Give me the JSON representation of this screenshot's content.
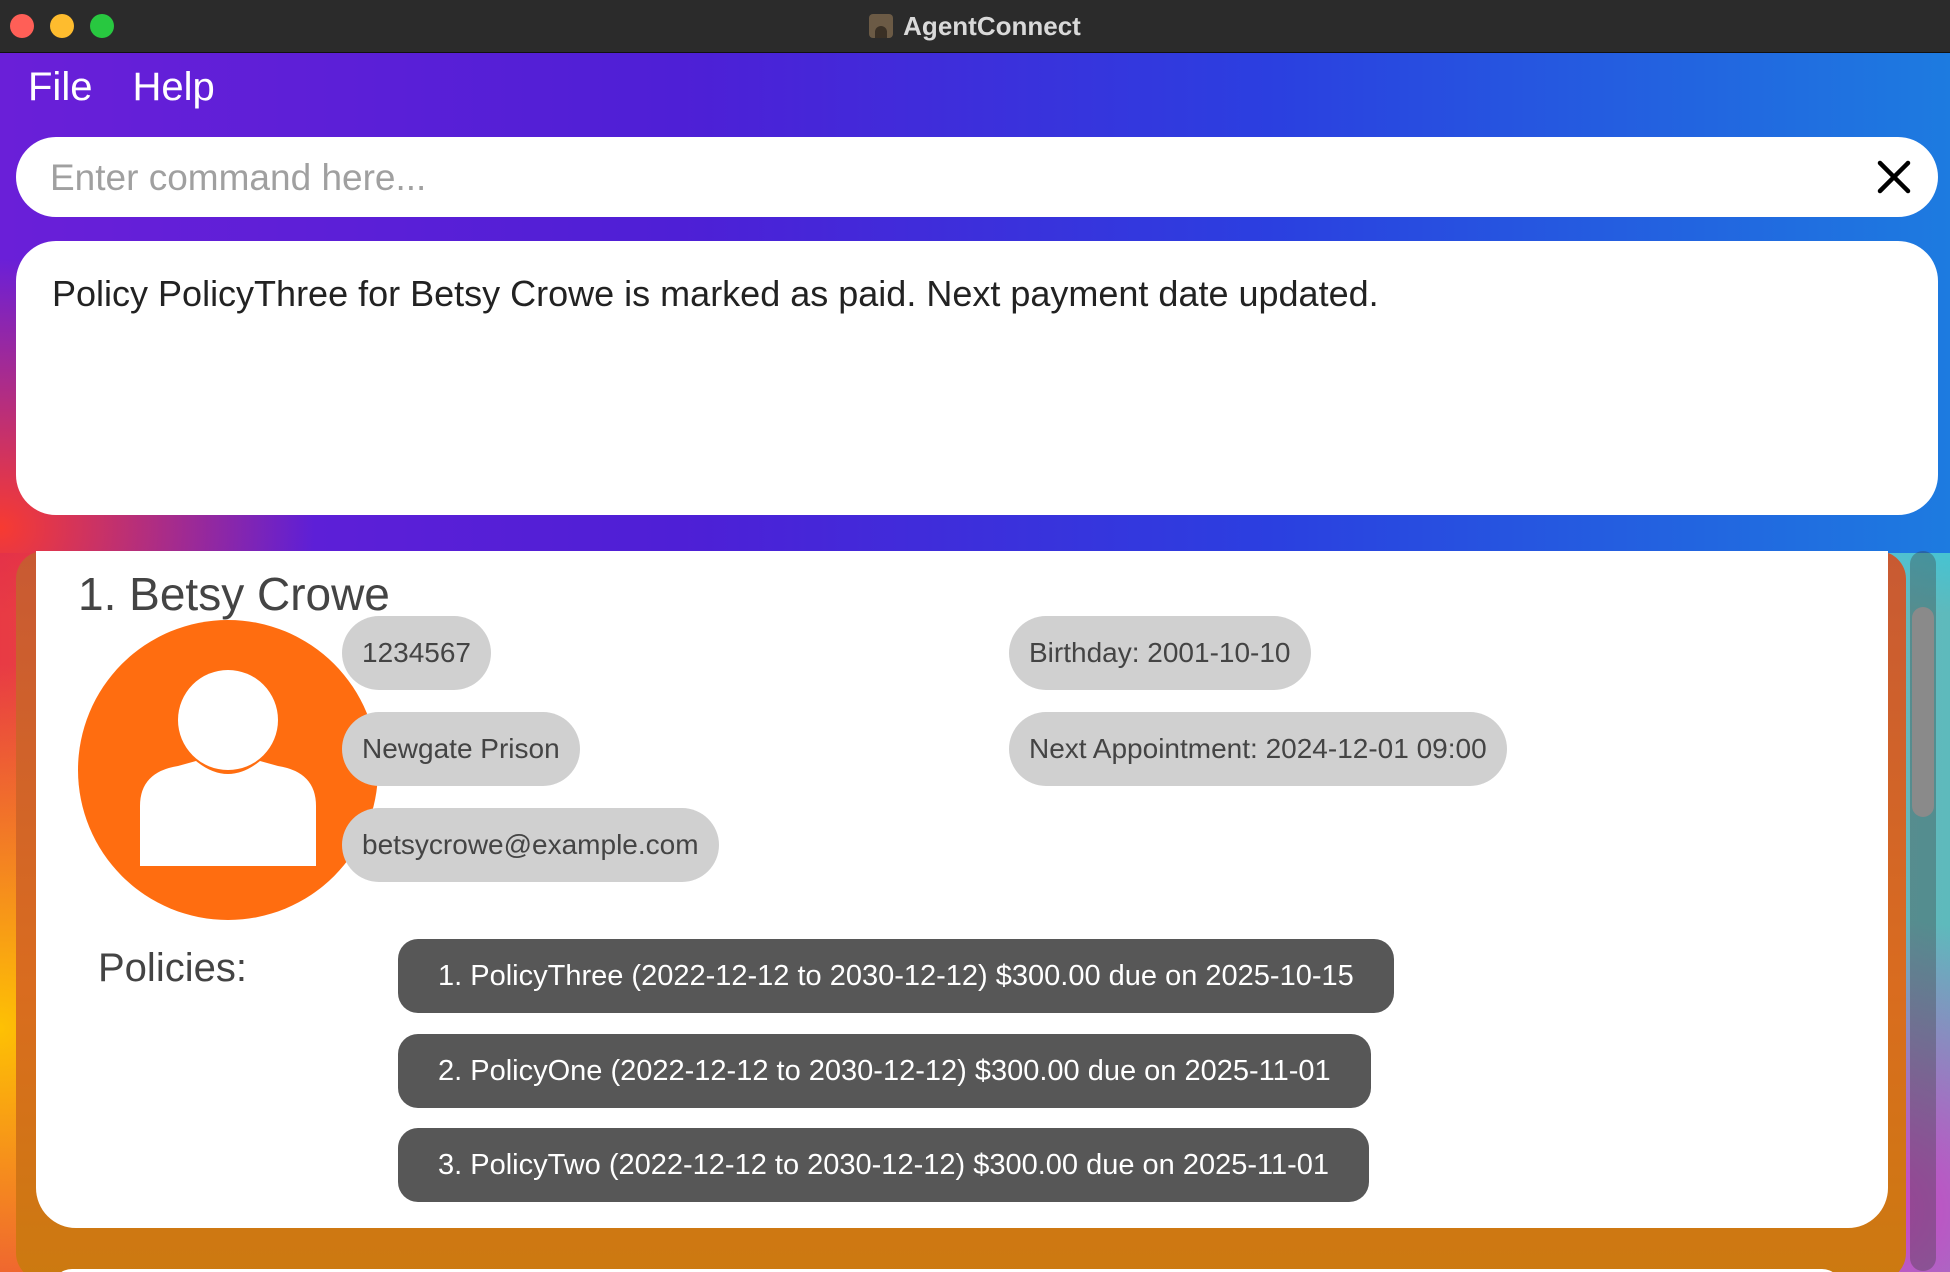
{
  "window": {
    "title": "AgentConnect"
  },
  "menu": {
    "file": "File",
    "help": "Help"
  },
  "command": {
    "placeholder": "Enter command here...",
    "value": ""
  },
  "result": {
    "message": "Policy PolicyThree for Betsy Crowe is marked as paid. Next payment date updated."
  },
  "colors": {
    "avatar": "#ff6d10",
    "chip": "#d0d0d0",
    "policy": "#575757"
  },
  "person": {
    "name": "1. Betsy Crowe",
    "phone": "1234567",
    "address": "Newgate Prison",
    "email": "betsycrowe@example.com",
    "birthday": "Birthday: 2001-10-10",
    "next_appointment": "Next Appointment: 2024-12-01 09:00",
    "policies_label": "Policies:",
    "policies": [
      "1. PolicyThree (2022-12-12 to 2030-12-12) $300.00 due on 2025-10-15",
      "2. PolicyOne (2022-12-12 to 2030-12-12) $300.00 due on 2025-11-01",
      "3. PolicyTwo (2022-12-12 to 2030-12-12) $300.00 due on 2025-11-01"
    ]
  }
}
